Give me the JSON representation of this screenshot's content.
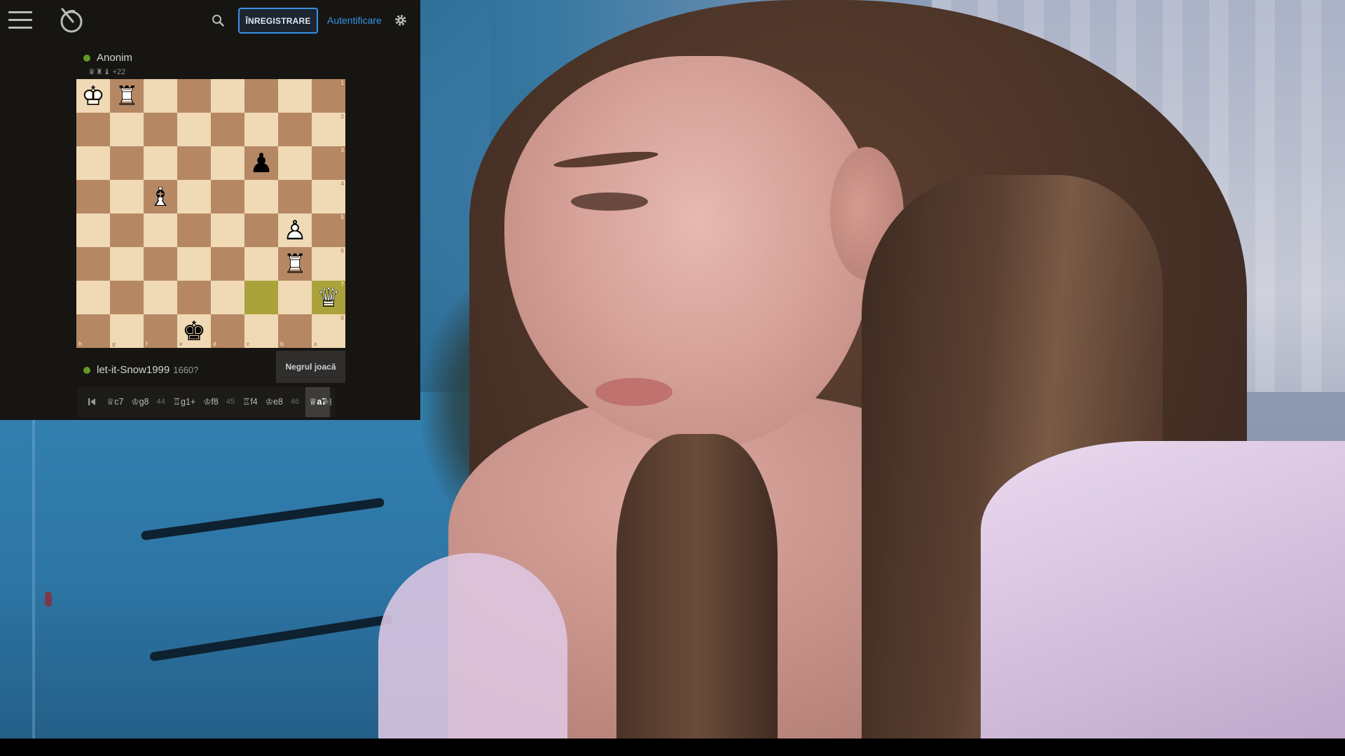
{
  "header": {
    "menu_icon": "hamburger-icon",
    "logo_icon": "lichess-logo-icon",
    "search_icon": "search-icon",
    "register_label": "ÎNREGISTRARE",
    "login_label": "Autentificare",
    "settings_icon": "gear-icon"
  },
  "top_player": {
    "name": "Anonim",
    "online": true,
    "material": [
      "queen",
      "rook",
      "bishop"
    ],
    "material_diff": "+22"
  },
  "board": {
    "orientation": "black",
    "file_labels": [
      "h",
      "g",
      "f",
      "e",
      "d",
      "c",
      "b",
      "a"
    ],
    "rank_labels": [
      "1",
      "2",
      "3",
      "4",
      "5",
      "6",
      "7",
      "8"
    ],
    "last_move": [
      "c7",
      "a7"
    ],
    "pieces": [
      {
        "square": "h1",
        "color": "white",
        "type": "king"
      },
      {
        "square": "g1",
        "color": "white",
        "type": "rook"
      },
      {
        "square": "c3",
        "color": "black",
        "type": "pawn"
      },
      {
        "square": "f4",
        "color": "white",
        "type": "bishop"
      },
      {
        "square": "b5",
        "color": "white",
        "type": "pawn"
      },
      {
        "square": "b6",
        "color": "white",
        "type": "rook"
      },
      {
        "square": "a7",
        "color": "white",
        "type": "queen"
      },
      {
        "square": "e8",
        "color": "black",
        "type": "king"
      }
    ]
  },
  "bottom_player": {
    "name": "let-it-Snow1999",
    "rating": "1660?",
    "online": true
  },
  "turn_indicator": "Negrul joacă",
  "moves": {
    "first_icon": "first-move-icon",
    "last_icon": "last-move-icon",
    "items": [
      {
        "text": "♕c7"
      },
      {
        "text": "♔g8"
      },
      {
        "text": "44"
      },
      {
        "text": "♖g1+"
      },
      {
        "text": "♔f8"
      },
      {
        "text": "45"
      },
      {
        "text": "♖f4"
      },
      {
        "text": "♔e8"
      },
      {
        "text": "46"
      },
      {
        "text": "♕a7"
      }
    ],
    "active_index": 9
  },
  "colors": {
    "panel_bg": "#161512",
    "light_square": "#f0d9b5",
    "dark_square": "#b58863",
    "last_move_light": "#cdd26a",
    "last_move_dark": "#aaa23a",
    "online_dot": "#629924",
    "accent": "#3692e7"
  }
}
